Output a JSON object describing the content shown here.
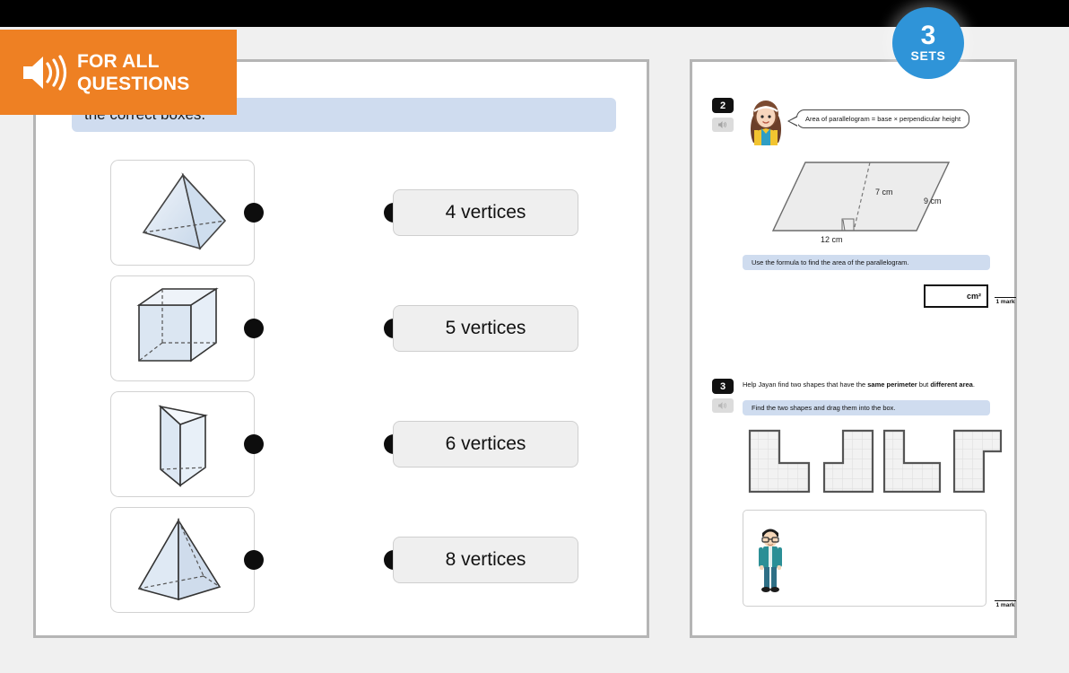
{
  "overlay": {
    "label_line1": "FOR ALL",
    "label_line2": "QUESTIONS",
    "icon": "speaker-icon",
    "color": "#ee8023"
  },
  "sets_badge": {
    "count": "3",
    "label": "SETS",
    "color": "#2f94d8"
  },
  "left_panel": {
    "instruction": "the correct boxes.",
    "shapes": [
      {
        "name": "tetrahedron",
        "alt": "triangular-based pyramid"
      },
      {
        "name": "cube",
        "alt": "cube"
      },
      {
        "name": "triangular-prism",
        "alt": "triangular prism"
      },
      {
        "name": "square-pyramid",
        "alt": "square-based pyramid"
      }
    ],
    "options": [
      {
        "label": "4 vertices"
      },
      {
        "label": "5 vertices"
      },
      {
        "label": "6 vertices"
      },
      {
        "label": "8 vertices"
      }
    ]
  },
  "right_panel": {
    "question2": {
      "number": "2",
      "speaker_icon": "speaker-icon",
      "avatar": "girl-avatar",
      "bubble_text": "Area of parallelogram = base × perpendicular height",
      "diagram": {
        "height_label": "7 cm",
        "side_label": "9 cm",
        "base_label": "12 cm",
        "right_angle": true
      },
      "instruction": "Use the formula to find the area of the parallelogram.",
      "answer_unit": "cm²",
      "answer_value": "",
      "marks": "1 mark"
    },
    "question3": {
      "number": "3",
      "speaker_icon": "speaker-icon",
      "prompt_parts": [
        "Help Jayan find two shapes that have the ",
        "same perimeter",
        " but ",
        "different area",
        "."
      ],
      "instruction": "Find the two shapes and drag them into the box.",
      "shapes": [
        {
          "name": "L-shape-1",
          "cols": 3,
          "rows": 6,
          "foot_cols": 3,
          "foot_rows": 3
        },
        {
          "name": "J-shape-2",
          "cols": 3,
          "rows": 6,
          "foot_cols": 3,
          "foot_rows": 4
        },
        {
          "name": "L-shape-3",
          "cols": 2,
          "rows": 6,
          "foot_cols": 3,
          "foot_rows": 3
        },
        {
          "name": "notch-shape-4",
          "cols": 3,
          "rows": 6,
          "foot_cols": 2,
          "foot_rows": 3
        }
      ],
      "dropbox_avatar": "boy-avatar",
      "marks": "1 mark"
    }
  }
}
